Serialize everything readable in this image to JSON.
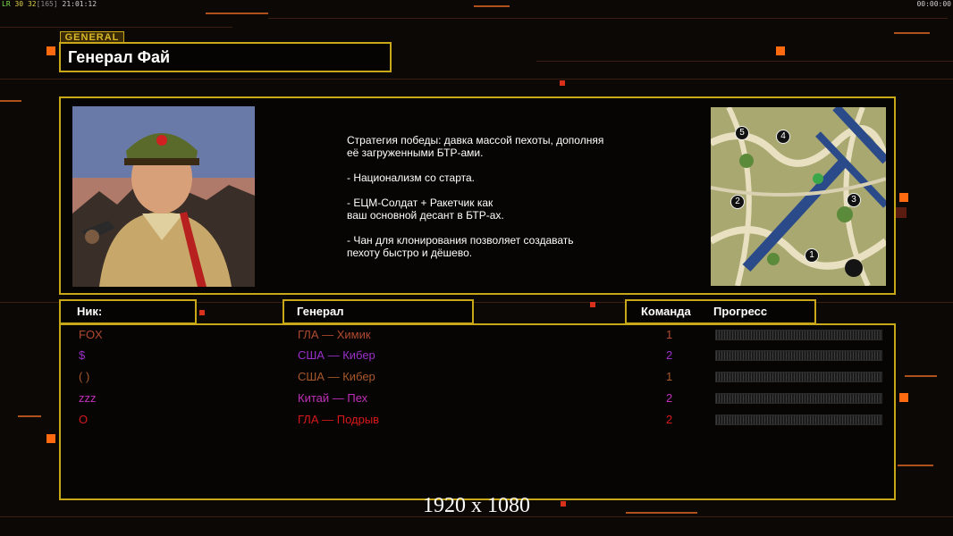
{
  "hud": {
    "left_prefix": "LR",
    "left_a": "30",
    "left_b": "32",
    "left_c": "[165]",
    "left_time": "21:01:12",
    "right_time": "00:00:00"
  },
  "general_tag": "GENERAL",
  "title": "Генерал Фай",
  "description": "Стратегия победы: давка массой пехоты, дополняя\n её загруженными БТР-ами.\n\n- Национализм со старта.\n\n- ЕЦМ-Солдат + Ракетчик как\nваш основной десант в БТР-ах.\n\n- Чан для клонирования позволяет создавать\n пехоту быстро и дёшево.",
  "map_markers": [
    "5",
    "4",
    "2",
    "3",
    "1"
  ],
  "headers": {
    "nick": "Ник:",
    "general": "Генерал",
    "team": "Команда",
    "progress": "Прогресс"
  },
  "players": [
    {
      "nick": "FOX",
      "general": "ГЛА — Химик",
      "team": "1",
      "color": "#b04a30",
      "progress": 0
    },
    {
      "nick": "$",
      "general": "США — Кибер",
      "team": "2",
      "color": "#9a30c8",
      "progress": 0
    },
    {
      "nick": "( )",
      "general": "США — Кибер",
      "team": "1",
      "color": "#a8582a",
      "progress": 0
    },
    {
      "nick": "zzz",
      "general": "Китай — Пех",
      "team": "2",
      "color": "#c030b8",
      "progress": 0
    },
    {
      "nick": "O",
      "general": "ГЛА — Подрыв",
      "team": "2",
      "color": "#d81818",
      "progress": 0
    }
  ],
  "resolution": "1920 x 1080",
  "colors": {
    "accent": "#c8a818",
    "background": "#0b0806"
  }
}
